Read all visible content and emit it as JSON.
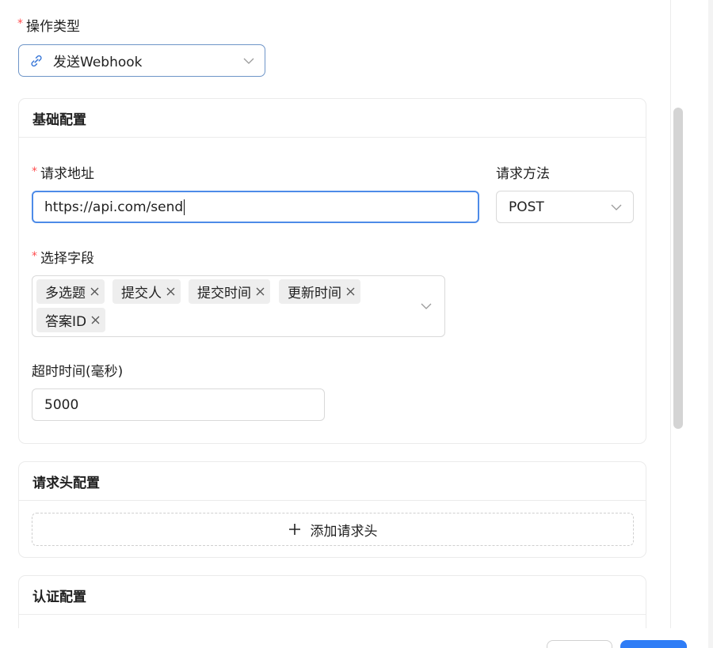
{
  "form": {
    "operation_type": {
      "label": "操作类型",
      "required_mark": "*",
      "value": "发送Webhook",
      "icon": "link-icon"
    }
  },
  "basic_config": {
    "title": "基础配置",
    "request_url": {
      "label": "请求地址",
      "required_mark": "*",
      "value": "https://api.com/send"
    },
    "request_method": {
      "label": "请求方法",
      "value": "POST"
    },
    "fields": {
      "label": "选择字段",
      "required_mark": "*",
      "tags": [
        "多选题",
        "提交人",
        "提交时间",
        "更新时间",
        "答案ID"
      ]
    },
    "timeout": {
      "label": "超时时间(毫秒)",
      "value": "5000"
    }
  },
  "headers_config": {
    "title": "请求头配置",
    "add_button_label": "添加请求头"
  },
  "auth_config": {
    "title": "认证配置"
  },
  "colors": {
    "required": "#ff4d4f",
    "focus_border": "#4d8be8",
    "primary": "#2f7df6"
  }
}
